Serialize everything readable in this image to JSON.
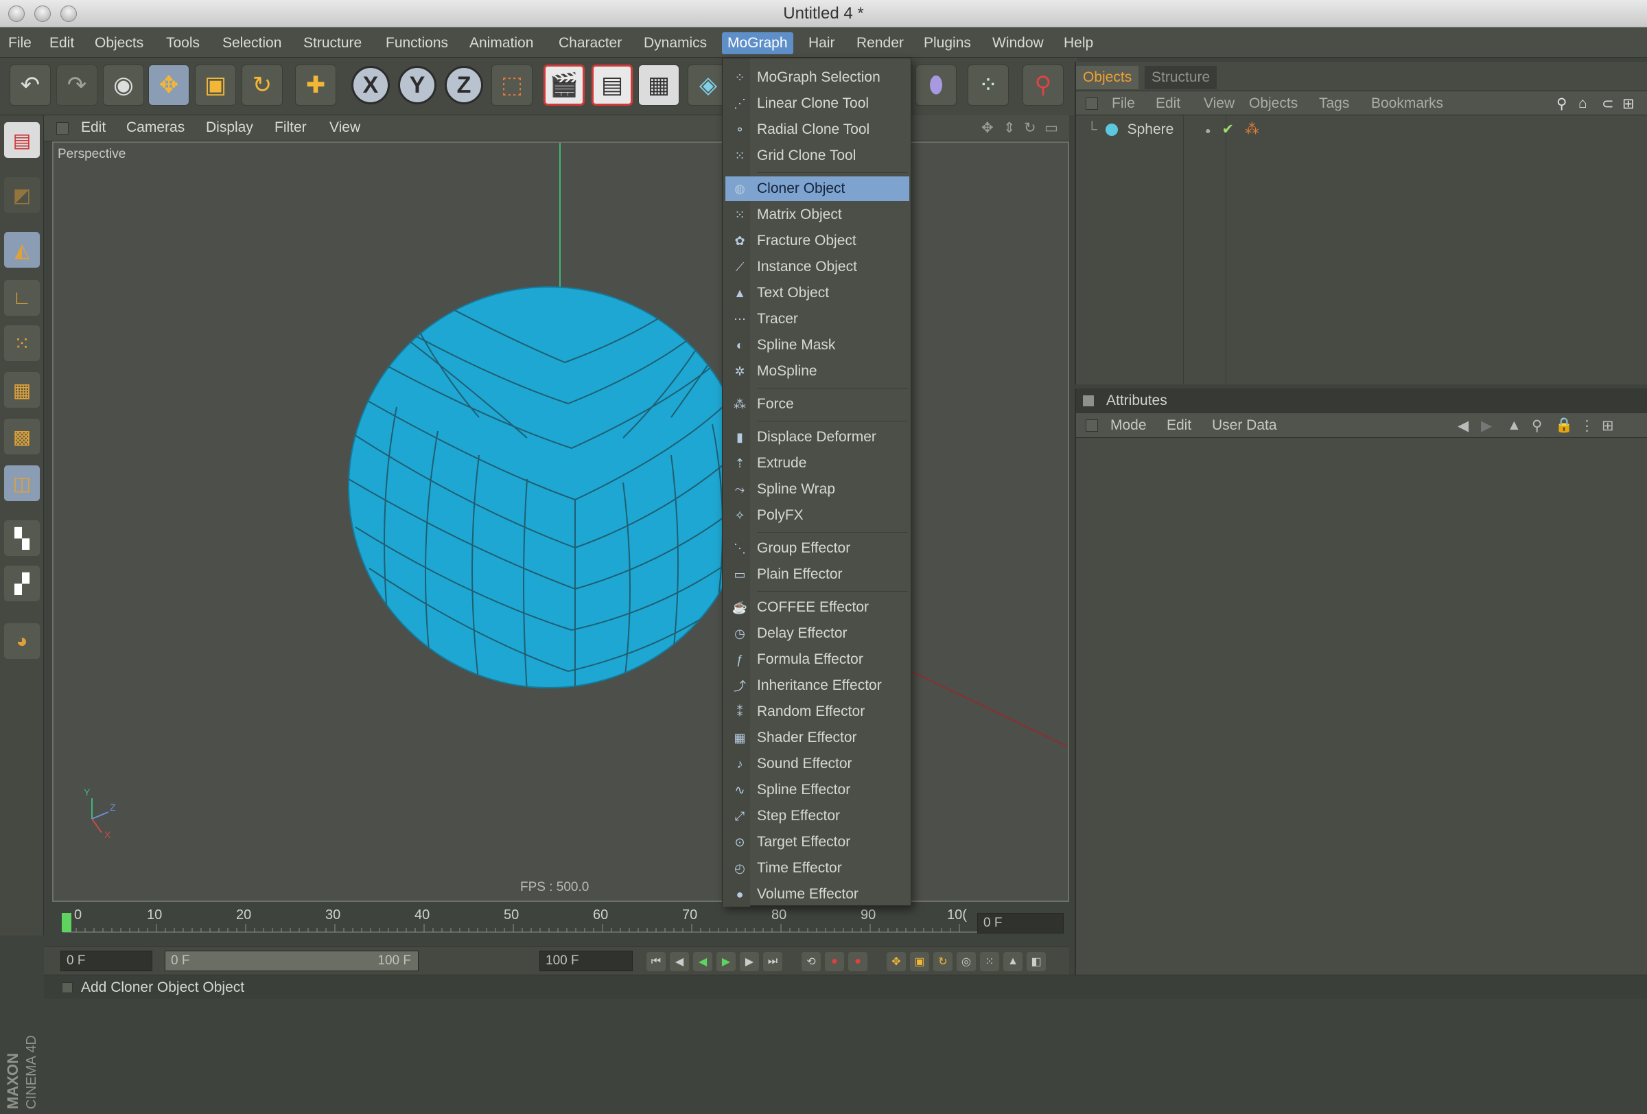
{
  "window": {
    "title": "Untitled 4 *"
  },
  "menubar": {
    "items": [
      "File",
      "Edit",
      "Objects",
      "Tools",
      "Selection",
      "Structure",
      "Functions",
      "Animation",
      "Character",
      "Dynamics",
      "MoGraph",
      "Hair",
      "Render",
      "Plugins",
      "Window",
      "Help"
    ],
    "active": "MoGraph"
  },
  "viewport": {
    "menu": [
      "Edit",
      "Cameras",
      "Display",
      "Filter",
      "View"
    ],
    "label": "Perspective",
    "fps": "FPS : 500.0",
    "axis_labels": {
      "y": "Y",
      "x": "X",
      "z": "Z"
    }
  },
  "mograph_menu": {
    "items": [
      {
        "label": "MoGraph Selection",
        "icon": "selection-icon"
      },
      {
        "label": "Linear Clone Tool",
        "icon": "linear-clone-icon"
      },
      {
        "label": "Radial Clone Tool",
        "icon": "radial-clone-icon"
      },
      {
        "label": "Grid Clone Tool",
        "icon": "grid-clone-icon"
      },
      {
        "label": "Cloner Object",
        "icon": "cloner-icon",
        "selected": true
      },
      {
        "label": "Matrix Object",
        "icon": "matrix-icon"
      },
      {
        "label": "Fracture Object",
        "icon": "fracture-icon"
      },
      {
        "label": "Instance Object",
        "icon": "instance-icon"
      },
      {
        "label": "Text Object",
        "icon": "text-object-icon"
      },
      {
        "label": "Tracer",
        "icon": "tracer-icon"
      },
      {
        "label": "Spline Mask",
        "icon": "spline-mask-icon"
      },
      {
        "label": "MoSpline",
        "icon": "mospline-icon"
      },
      {
        "label": "Force",
        "icon": "force-icon"
      },
      {
        "label": "Displace Deformer",
        "icon": "displace-icon"
      },
      {
        "label": "Extrude",
        "icon": "extrude-icon"
      },
      {
        "label": "Spline Wrap",
        "icon": "spline-wrap-icon"
      },
      {
        "label": "PolyFX",
        "icon": "polyfx-icon"
      },
      {
        "label": "Group Effector",
        "icon": "group-effector-icon"
      },
      {
        "label": "Plain Effector",
        "icon": "plain-effector-icon"
      },
      {
        "label": "COFFEE Effector",
        "icon": "coffee-effector-icon"
      },
      {
        "label": "Delay Effector",
        "icon": "delay-effector-icon"
      },
      {
        "label": "Formula Effector",
        "icon": "formula-effector-icon"
      },
      {
        "label": "Inheritance Effector",
        "icon": "inheritance-effector-icon"
      },
      {
        "label": "Random Effector",
        "icon": "random-effector-icon"
      },
      {
        "label": "Shader Effector",
        "icon": "shader-effector-icon"
      },
      {
        "label": "Sound Effector",
        "icon": "sound-effector-icon"
      },
      {
        "label": "Spline Effector",
        "icon": "spline-effector-icon"
      },
      {
        "label": "Step Effector",
        "icon": "step-effector-icon"
      },
      {
        "label": "Target Effector",
        "icon": "target-effector-icon"
      },
      {
        "label": "Time Effector",
        "icon": "time-effector-icon"
      },
      {
        "label": "Volume Effector",
        "icon": "volume-effector-icon"
      }
    ]
  },
  "objects_panel": {
    "tabs": [
      "Objects",
      "Structure"
    ],
    "active_tab": "Objects",
    "menu": [
      "File",
      "Edit",
      "View",
      "Objects",
      "Tags",
      "Bookmarks"
    ],
    "objects": [
      {
        "name": "Sphere"
      }
    ]
  },
  "attributes_panel": {
    "title": "Attributes",
    "menu": [
      "Mode",
      "Edit",
      "User Data"
    ]
  },
  "timeline": {
    "ticks": [
      "0",
      "10",
      "20",
      "30",
      "40",
      "50",
      "60",
      "70",
      "80",
      "90",
      "10("
    ],
    "current_frame": "0 F",
    "start_field": "0 F",
    "range_start": "0 F",
    "range_end": "100 F",
    "end_field": "100 F"
  },
  "status": {
    "text": "Add Cloner Object Object"
  },
  "brand": "MAXON CINEMA 4D",
  "colors": {
    "accent": "#f0a030",
    "selection": "#7ea3cf",
    "sphere": "#1ea7d2"
  }
}
